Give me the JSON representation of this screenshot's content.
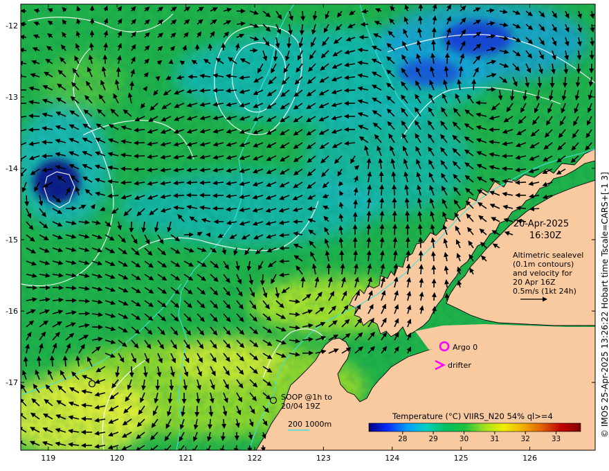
{
  "map": {
    "lon_range": [
      118.6,
      126.95
    ],
    "lat_range": [
      -17.95,
      -11.7
    ],
    "lon_ticks": [
      119,
      120,
      121,
      122,
      123,
      124,
      125,
      126
    ],
    "lat_ticks": [
      -12,
      -13,
      -14,
      -15,
      -16,
      -17
    ],
    "lon_labels": [
      "119",
      "120",
      "121",
      "122",
      "123",
      "124",
      "125",
      "126"
    ],
    "lat_labels": [
      "-12",
      "-13",
      "-14",
      "-15",
      "-16",
      "-17"
    ],
    "colors": {
      "land": "#f9c9a0",
      "ocean_base": "#1fb24a",
      "warm_zone": "#9fdc2a",
      "hot_zone": "#e8f03a",
      "cool_zone": "#15b8c8",
      "cold_zone": "#1a3ad8",
      "coldest_core": "#0a1a8a",
      "sealevel_contour": "#ffffff",
      "isobath": "#40e0e0",
      "vector": "#000000",
      "argo": "#ff00ff",
      "drifter": "#ff00ff"
    }
  },
  "timestamp": {
    "date": "20-Apr-2025",
    "time": "16:30Z"
  },
  "altimetry_note": {
    "line1": "Altimetric sealevel",
    "line2": "(0.1m contours)",
    "line3": "and velocity for",
    "line4": "20 Apr 16Z",
    "line5": "0.5m/s (1kt 24h)"
  },
  "legend": {
    "argo_label": "Argo 0",
    "drifter_label": "drifter",
    "soop_line1": "SOOP @1h to",
    "soop_line2": "20/04 19Z",
    "isobath_label": "200  1000m"
  },
  "colorbar": {
    "title": "Temperature (°C) VIIRS_N20 54% ql>=4",
    "ticks": [
      "28",
      "29",
      "30",
      "31",
      "32",
      "33"
    ],
    "tick_values": [
      28,
      29,
      30,
      31,
      32,
      33
    ],
    "range": [
      26.9,
      33.8
    ],
    "stops": [
      "#000080",
      "#0030ff",
      "#00a0ff",
      "#00d0c0",
      "#00c060",
      "#20c040",
      "#a0e020",
      "#f0f000",
      "#f0b000",
      "#e06000",
      "#c00000",
      "#800000"
    ]
  },
  "side_caption": "© IMOS 25-Apr-2025 13:26:22 Hobart time Tscale=CARS+[-1 3]"
}
